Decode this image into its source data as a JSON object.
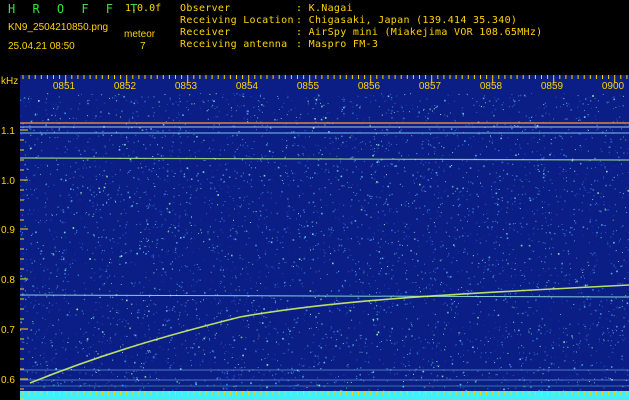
{
  "header": {
    "app_title": "H R O F F T",
    "version": "1.0.0f",
    "filename": "KN9_2504210850.png",
    "datetime": "25.04.21 08:50",
    "meteor_label": "meteor",
    "meteor_count": "7",
    "info": [
      {
        "key": "Observer",
        "value": ": K.Nagai"
      },
      {
        "key": "Receiving Location",
        "value": ": Chigasaki, Japan (139.414 35.340)"
      },
      {
        "key": "Receiver",
        "value": ": AirSpy mini (Miakejima VOR 108.65MHz)"
      },
      {
        "key": "Receiving antenna",
        "value": ": Maspro FM-3"
      }
    ]
  },
  "spectrogram": {
    "unit_label": "kHz",
    "y_ticks": [
      "1.1",
      "1.0",
      "0.9",
      "0.8",
      "0.7",
      "0.6"
    ],
    "y_values": [
      1.1,
      1.0,
      0.9,
      0.8,
      0.7,
      0.6
    ],
    "time_labels": [
      "0851",
      "0852",
      "0853",
      "0854",
      "0855",
      "0856",
      "0857",
      "0858",
      "0859",
      "0900"
    ],
    "colors": {
      "background": "#0b1f8a",
      "label": "#ffd400",
      "grid_text": "#ffd400",
      "bottom_bar": "#3ff0ff"
    }
  }
}
